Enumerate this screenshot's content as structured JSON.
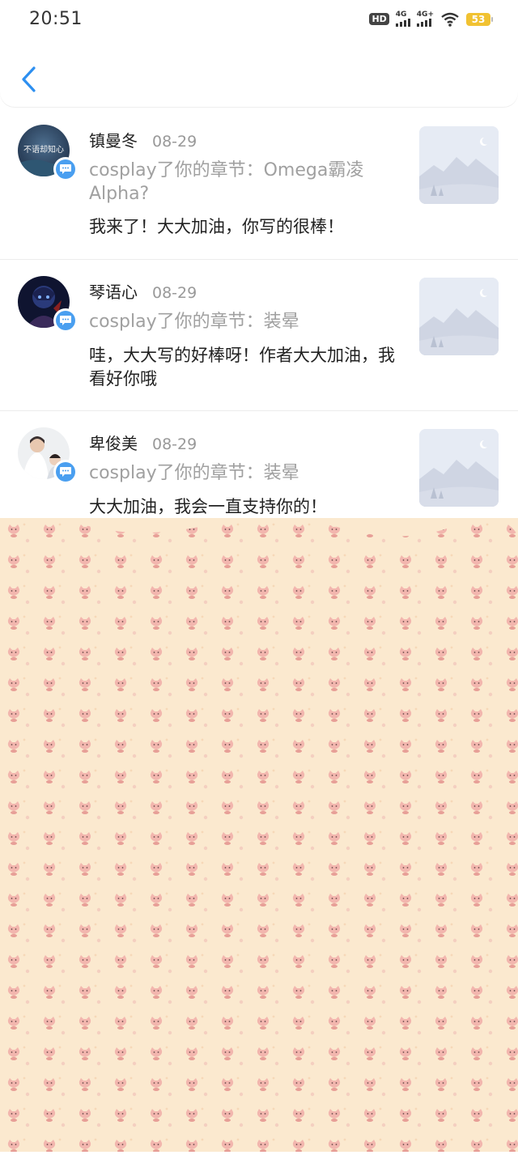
{
  "status_bar": {
    "time": "20:51",
    "hd_label": "HD",
    "sim1_label": "4G",
    "sim2_label": "4G+",
    "battery": "53",
    "icons": [
      "hd-icon",
      "signal-4g-icon",
      "signal-4g-plus-icon",
      "wifi-icon",
      "battery-icon"
    ]
  },
  "header": {
    "back_icon": "chevron-left-icon",
    "accent_color": "#2d8ff0"
  },
  "messages": [
    {
      "username": "镇曼冬",
      "date": "08-29",
      "chapter_line": "cosplay了你的章节：Omega霸凌Alpha?",
      "comment": "我来了！大大加油，你写的很棒！",
      "avatar_text": "不语却知心"
    },
    {
      "username": "琴语心",
      "date": "08-29",
      "chapter_line": "cosplay了你的章节：装晕",
      "comment": "哇，大大写的好棒呀！作者大大加油，我看好你哦"
    },
    {
      "username": "卑俊美",
      "date": "08-29",
      "chapter_line": "cosplay了你的章节：装晕",
      "comment": "大大加油，我会一直支持你的！"
    }
  ],
  "colors": {
    "badge": "#4a9ff0",
    "secondary_text": "#a0a0a0",
    "wallpaper": "#fbe9cf"
  }
}
